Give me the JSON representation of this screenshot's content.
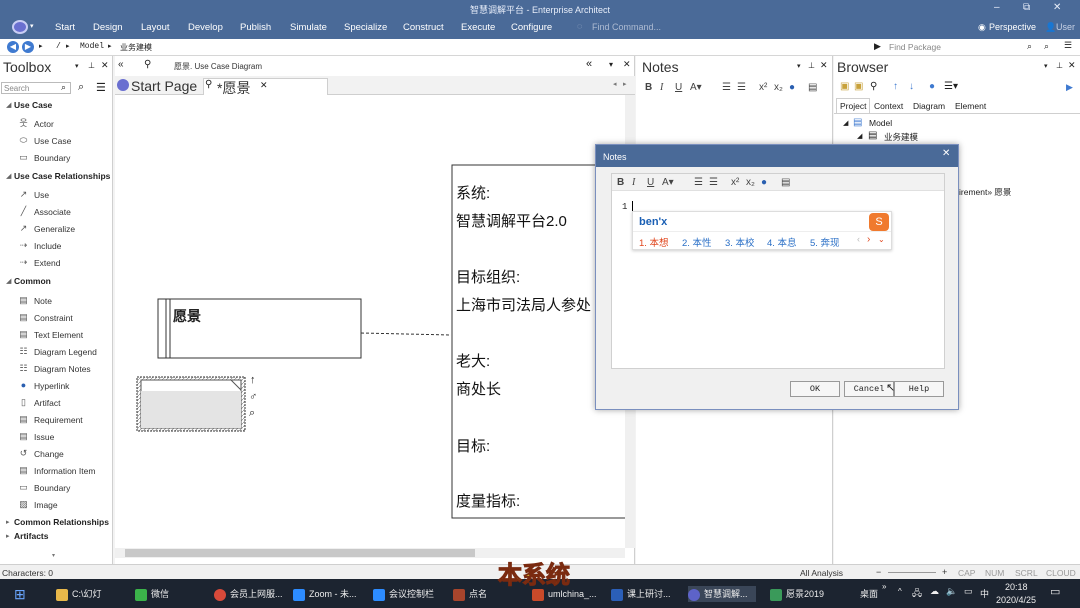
{
  "title_bar": {
    "title": "智慧调解平台 - Enterprise Architect",
    "minimize": "–",
    "restore": "⧉",
    "close": "✕"
  },
  "menu": {
    "items": [
      "Start",
      "Design",
      "Layout",
      "Develop",
      "Publish",
      "Simulate",
      "Specialize",
      "Construct",
      "Execute",
      "Configure"
    ],
    "find_placeholder": "Find Command...",
    "perspective": "Perspective",
    "user": "User"
  },
  "address": {
    "path": [
      "/",
      "Model",
      "业务建模"
    ],
    "find_package_placeholder": "Find Package"
  },
  "toolbox": {
    "title": "Toolbox",
    "search_placeholder": "Search",
    "sections": [
      {
        "label": "Use Case",
        "items": [
          "Actor",
          "Use Case",
          "Boundary"
        ]
      },
      {
        "label": "Use Case Relationships",
        "items": [
          "Use",
          "Associate",
          "Generalize",
          "Include",
          "Extend"
        ]
      },
      {
        "label": "Common",
        "items": [
          "Note",
          "Constraint",
          "Text Element",
          "Diagram Legend",
          "Diagram Notes",
          "Hyperlink",
          "Artifact",
          "Requirement",
          "Issue",
          "Change",
          "Information Item",
          "Boundary",
          "Image"
        ]
      }
    ],
    "collapsed": [
      "Common Relationships",
      "Artifacts"
    ]
  },
  "diagram": {
    "breadcrumb": "愿景. Use Case Diagram",
    "tabs": [
      {
        "label": "Start Page"
      },
      {
        "label": "*愿景"
      }
    ],
    "element_title": "愿景",
    "note_lines": [
      "系统:",
      "智慧调解平台2.0",
      "",
      "目标组织:",
      "上海市司法局人参处",
      "",
      "老大:",
      "商处长",
      "",
      "目标:",
      "",
      "度量指标:"
    ]
  },
  "notes_pane": {
    "title": "Notes"
  },
  "browser": {
    "title": "Browser",
    "tabs": [
      "Project",
      "Context",
      "Diagram",
      "Element"
    ],
    "tree": [
      "Model",
      "业务建模"
    ],
    "partial_item": "irement» 愿景"
  },
  "notes_dialog": {
    "title": "Notes",
    "line_number": "1",
    "buttons": {
      "ok": "OK",
      "cancel": "Cancel",
      "help": "Help"
    }
  },
  "ime": {
    "input": "ben'x",
    "candidates": [
      "1. 本想",
      "2. 本性",
      "3. 本校",
      "4. 本息",
      "5. 奔现"
    ]
  },
  "status_bar": {
    "characters": "Characters: 0",
    "mode": "All Analysis",
    "caps": "CAP",
    "num": "NUM",
    "scrl": "SCRL",
    "cloud": "CLOUD"
  },
  "subtitle": "本系统",
  "taskbar": {
    "items": [
      {
        "label": "C:\\幻灯",
        "color": "#e8b84a"
      },
      {
        "label": "微信",
        "color": "#3bb34a"
      },
      {
        "label": "会员上网服...",
        "color": "#d84a3a"
      },
      {
        "label": "Zoom - 未...",
        "color": "#2d8cff"
      },
      {
        "label": "会议控制栏",
        "color": "#2d8cff"
      },
      {
        "label": "点名",
        "color": "#a8452c"
      },
      {
        "label": "umlchina_...",
        "color": "#c94a2a"
      },
      {
        "label": "课上研讨...",
        "color": "#2b5fb8"
      },
      {
        "label": "智慧调解...",
        "color": "#5d63c9"
      },
      {
        "label": "愿景2019",
        "color": "#3a9a5a"
      }
    ],
    "desktop": "桌面",
    "ime_indicator": "中",
    "time": "20:18",
    "date": "2020/4/25"
  },
  "colors": {
    "titlebar": "#4a6a98",
    "ime_input": "#1a5fb4",
    "ime_candidate": "#e0451c",
    "taskbar": "#1c2430"
  }
}
